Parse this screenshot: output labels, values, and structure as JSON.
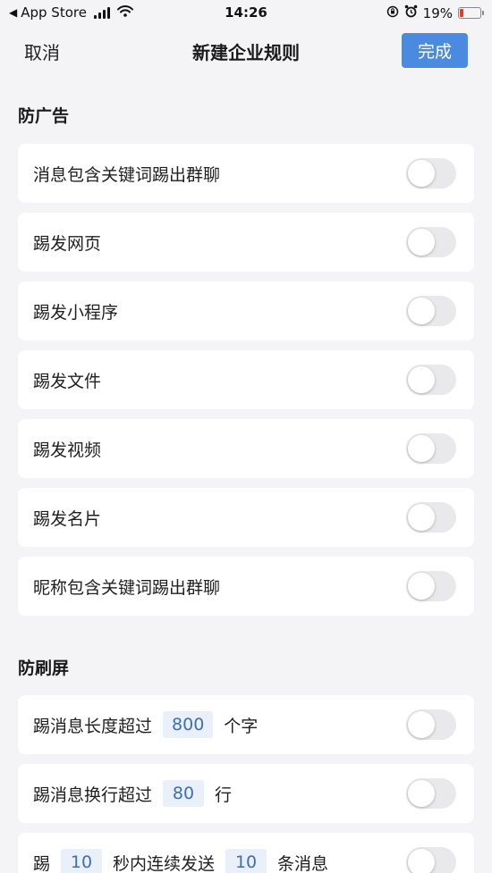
{
  "status_bar": {
    "back_app": "App Store",
    "time": "14:26",
    "battery_percent": "19%",
    "battery_level": 0.19,
    "battery_color": "#e23b2e",
    "icons": [
      "back-triangle-icon",
      "signal-icon",
      "wifi-icon",
      "orientation-lock-icon",
      "alarm-icon",
      "battery-icon"
    ]
  },
  "nav": {
    "cancel": "取消",
    "title": "新建企业规则",
    "done": "完成",
    "done_color": "#4a8ae0"
  },
  "anti_ads": {
    "title": "防广告",
    "items": [
      {
        "label": "消息包含关键词踢出群聊",
        "on": false
      },
      {
        "label": "踢发网页",
        "on": false
      },
      {
        "label": "踢发小程序",
        "on": false
      },
      {
        "label": "踢发文件",
        "on": false
      },
      {
        "label": "踢发视频",
        "on": false
      },
      {
        "label": "踢发名片",
        "on": false
      },
      {
        "label": "昵称包含关键词踢出群聊",
        "on": false
      }
    ]
  },
  "anti_spam": {
    "title": "防刷屏",
    "length_rule": {
      "prefix": "踢消息长度超过",
      "value": "800",
      "suffix": "个字",
      "on": false
    },
    "lines_rule": {
      "prefix": "踢消息换行超过",
      "value": "80",
      "suffix": "行",
      "on": false
    },
    "frequency_rule": {
      "prefix": "踢",
      "seconds": "10",
      "middle": "秒内连续发送",
      "count": "10",
      "suffix": "条消息",
      "on": false
    }
  }
}
